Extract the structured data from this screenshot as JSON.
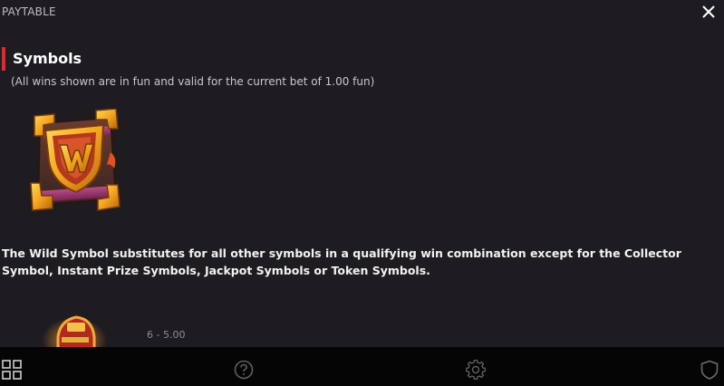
{
  "header": {
    "title": "PAYTABLE",
    "close_icon": "close-icon"
  },
  "section": {
    "title": "Symbols",
    "note": "(All wins shown are in fun and valid for the current bet of 1.00 fun)",
    "accent_color": "#e0292b"
  },
  "wild": {
    "icon": "wild-symbol-icon",
    "description": "The Wild Symbol substitutes for all other symbols in a qualifying win combination except for the Collector Symbol, Instant Prize Symbols, Jackpot Symbols or Token Symbols."
  },
  "next_symbol": {
    "icon": "symbol-icon",
    "payout": "6 - 5.00"
  },
  "footer": {
    "icons": [
      "grid-menu-icon",
      "help-icon",
      "settings-icon",
      "shield-icon"
    ]
  }
}
